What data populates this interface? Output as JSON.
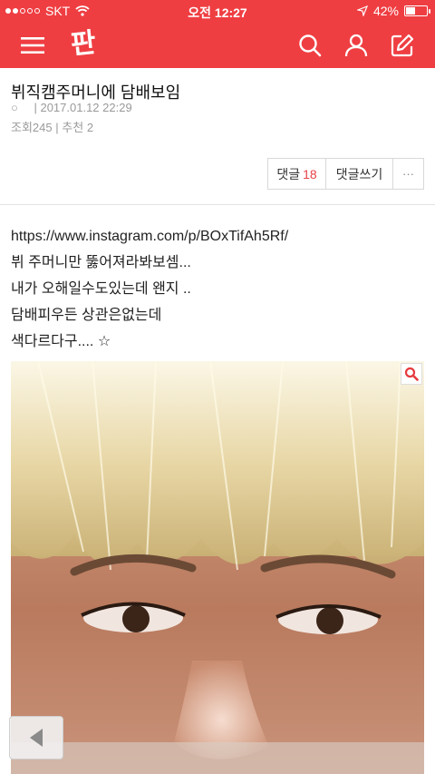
{
  "status_bar": {
    "carrier": "SKT",
    "time": "오전 12:27",
    "battery": "42%"
  },
  "navbar": {
    "logo": "판"
  },
  "post": {
    "title": "뷔직캠주머니에 담배보임",
    "author": "○",
    "date": "| 2017.01.12 22:29",
    "views_label": "조회",
    "views": "245",
    "sep": "|",
    "recommend_label": "추천",
    "recommend": "2"
  },
  "actions": {
    "comments_label": "댓글",
    "comments_count": "18",
    "write_comment": "댓글쓰기",
    "more": "···"
  },
  "body_lines": [
    "https://www.instagram.com/p/BOxTifAh5Rf/",
    "뷔 주머니만 뚫어져라봐보셈...",
    "내가 오해일수도있는데 왠지 ..",
    "담배피우든 상관은없는데",
    "색다르다구.... ☆"
  ],
  "colors": {
    "brand": "#ef3e42",
    "comment_count": "#e84146"
  }
}
